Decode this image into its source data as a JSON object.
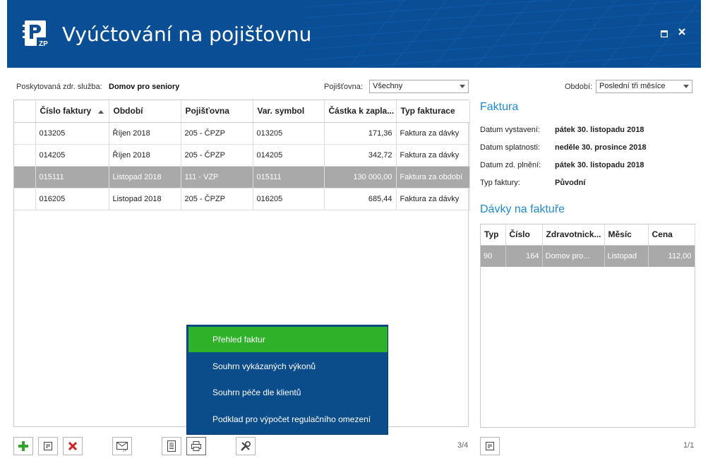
{
  "header": {
    "title": "Vyúčtování na pojišťovnu",
    "logo_text": "ZP"
  },
  "filters": {
    "service_label": "Poskytovaná zdr. služba:",
    "service_value": "Domov pro seniory",
    "insurer_label": "Pojišťovna:",
    "insurer_value": "Všechny",
    "period_label": "Období:",
    "period_value": "Poslední tři měsíce"
  },
  "invoices": {
    "columns": [
      "Číslo faktury",
      "Období",
      "Pojišťovna",
      "Var. symbol",
      "Částka k zapla...",
      "Typ fakturace"
    ],
    "rows": [
      {
        "number": "013205",
        "period": "Říjen 2018",
        "insurer": "205 - ČPZP",
        "vs": "013205",
        "amount": "171,36",
        "type": "Faktura za dávky"
      },
      {
        "number": "014205",
        "period": "Říjen 2018",
        "insurer": "205 - ČPZP",
        "vs": "014205",
        "amount": "342,72",
        "type": "Faktura za dávky"
      },
      {
        "number": "015111",
        "period": "Listopad 2018",
        "insurer": "111 - VZP",
        "vs": "015111",
        "amount": "130 000,00",
        "type": "Faktura za období"
      },
      {
        "number": "016205",
        "period": "Listopad 2018",
        "insurer": "205 - ČPZP",
        "vs": "016205",
        "amount": "685,44",
        "type": "Faktura za dávky"
      }
    ],
    "pager": "3/4"
  },
  "invoice_detail": {
    "title": "Faktura",
    "issued_label": "Datum vystavení:",
    "issued_value": "pátek 30. listopadu 2018",
    "due_label": "Datum splatnosti:",
    "due_value": "neděle 30. prosince 2018",
    "taxdate_label": "Datum zd. plnění:",
    "taxdate_value": "pátek 30. listopadu 2018",
    "type_label": "Typ faktury:",
    "type_value": "Původní"
  },
  "batches": {
    "title": "Dávky na faktuře",
    "columns": [
      "Typ",
      "Číslo",
      "Zdravotnick...",
      "Měsíc",
      "Cena"
    ],
    "rows": [
      {
        "type": "90",
        "number": "164",
        "facility": "Domov pro...",
        "month": "Listopad",
        "price": "112,00"
      }
    ],
    "pager": "1/1"
  },
  "report_menu": {
    "items": [
      "Přehled faktur",
      "Souhrn vykázaných výkonů",
      "Souhrn péče dle klientů",
      "Podklad pro výpočet regulačního omezení"
    ]
  },
  "colors": {
    "header": "#0a4f96",
    "accent": "#1e8ad0",
    "menu": "#0b4c8a",
    "menu_active": "#2fb12a",
    "selected_row": "#a9a9a9"
  }
}
